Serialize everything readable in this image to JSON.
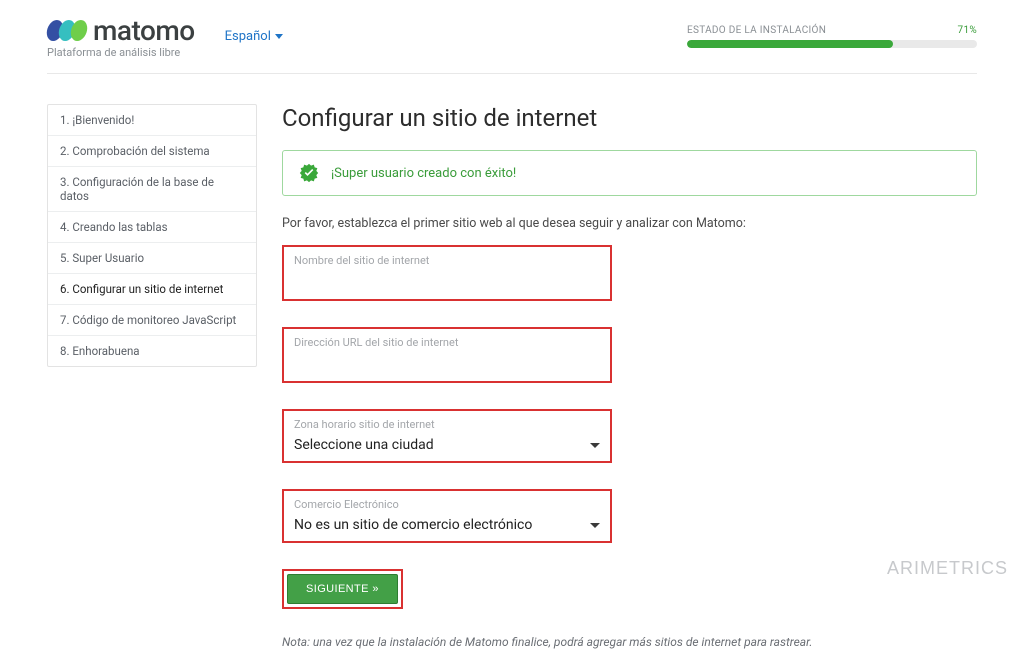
{
  "header": {
    "logo_text": "matomo",
    "tagline": "Plataforma de análisis libre",
    "language": "Español",
    "progress_label": "ESTADO DE LA INSTALACIÓN",
    "progress_pct": "71%",
    "progress_value": 71
  },
  "steps": [
    {
      "label": "1. ¡Bienvenido!"
    },
    {
      "label": "2. Comprobación del sistema"
    },
    {
      "label": "3. Configuración de la base de datos"
    },
    {
      "label": "4. Creando las tablas"
    },
    {
      "label": "5. Super Usuario"
    },
    {
      "label": "6. Configurar un sitio de internet",
      "active": true
    },
    {
      "label": "7. Código de monitoreo JavaScript"
    },
    {
      "label": "8. Enhorabuena"
    }
  ],
  "content": {
    "title": "Configurar un sitio de internet",
    "success_msg": "¡Super usuario creado con éxito!",
    "instruction": "Por favor, establezca el primer sitio web al que desea seguir y analizar con Matomo:",
    "fields": {
      "site_name_label": "Nombre del sitio de internet",
      "url_label": "Dirección URL del sitio de internet",
      "timezone_label": "Zona horario sitio de internet",
      "timezone_value": "Seleccione una ciudad",
      "ecommerce_label": "Comercio Electrónico",
      "ecommerce_value": "No es un sitio de comercio electrónico"
    },
    "next_button": "SIGUIENTE »",
    "note": "Nota: una vez que la instalación de Matomo finalice, podrá agregar más sitios de internet para rastrear."
  },
  "watermark": "ARIMETRICS"
}
